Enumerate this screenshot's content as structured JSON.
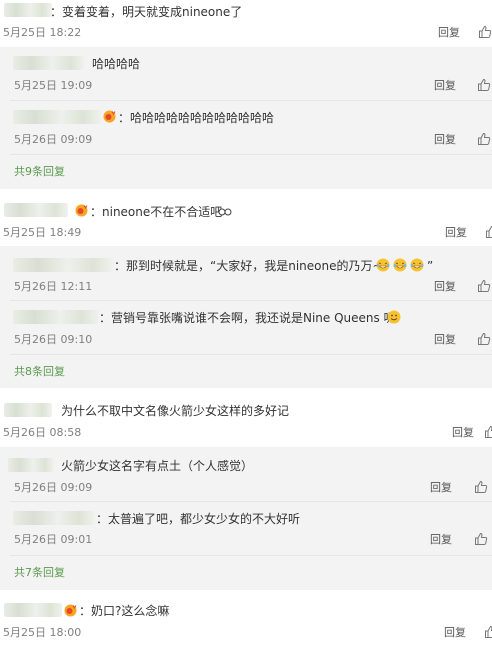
{
  "labels": {
    "reply": "回复"
  },
  "thread1": {
    "text": "：变着变着，明天就变成nineone了",
    "time": "5月25日 18:22",
    "subs": [
      {
        "text": "哈哈哈哈",
        "time": "5月25日 19:09"
      },
      {
        "text": "：哈哈哈哈哈哈哈哈哈哈哈哈",
        "time": "5月26日 09:09"
      }
    ],
    "more": "共9条回复"
  },
  "thread2": {
    "text": "：nineone不在不合适吧",
    "time": "5月25日 18:49",
    "subs": [
      {
        "text": "：那到时候就是，“大家好，我是nineone的乃万~",
        "suffix": "”",
        "time": "5月26日 12:11"
      },
      {
        "text": "：营销号靠张嘴说谁不会啊，我还说是Nine Queens 呢",
        "time": "5月26日 09:10"
      }
    ],
    "more": "共8条回复"
  },
  "thread3": {
    "text": "为什么不取中文名像火箭少女这样的多好记",
    "time": "5月26日 08:58",
    "subs": [
      {
        "text": "火箭少女这名字有点土（个人感觉）",
        "time": "5月26日 09:09"
      },
      {
        "text": "：太普遍了吧，都少女少女的不大好听",
        "time": "5月26日 09:01"
      }
    ],
    "more": "共7条回复"
  },
  "thread4": {
    "text": "：奶口?这么念嘛",
    "time": "5月25日 18:00"
  },
  "icons": {
    "like": "thumbs-up-icon",
    "badge": "verified-badge-icon",
    "emoji_laugh": "laughing-tears-emoji",
    "emoji_smile": "smile-emoji",
    "emoji_glasses": "glasses-emoji"
  },
  "colors": {
    "link_green": "#5a9a4e",
    "subpanel_bg": "#f3f3f3"
  }
}
